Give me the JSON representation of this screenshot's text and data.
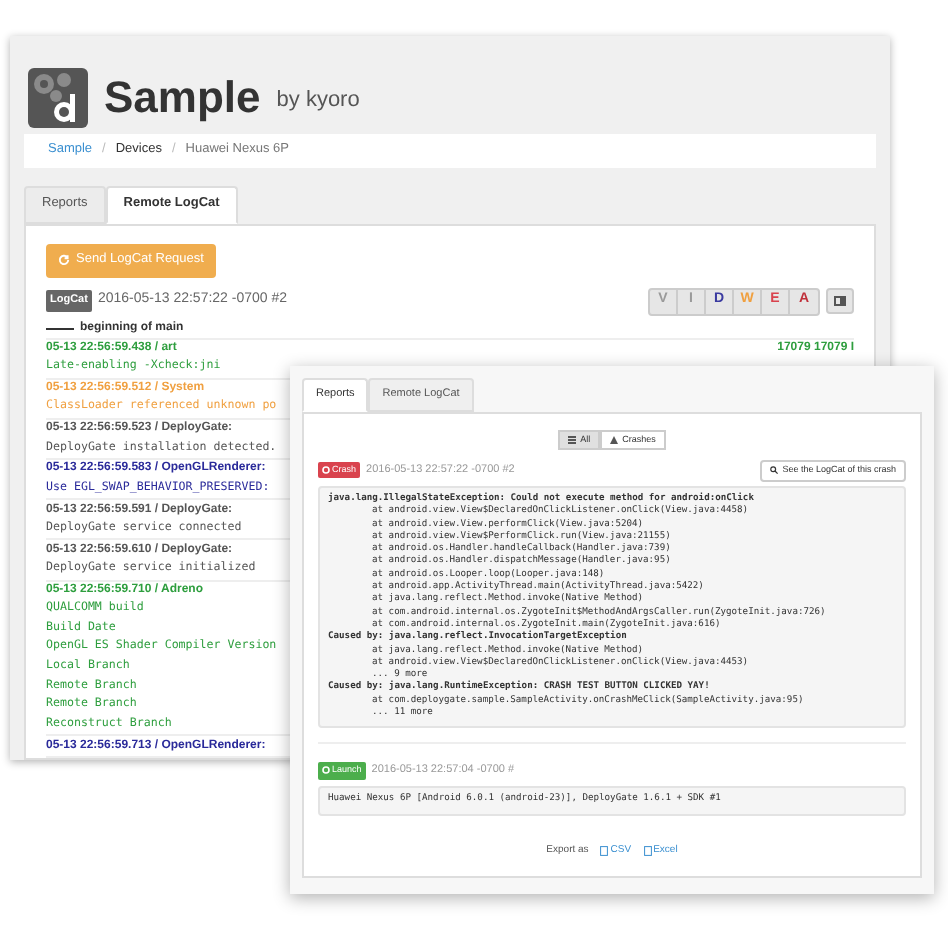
{
  "back_window": {
    "app_title": "Sample",
    "app_owner": "by kyoro",
    "breadcrumb": [
      {
        "label": "Sample",
        "link": true
      },
      {
        "label": "Devices",
        "link": false
      },
      {
        "label": "Huawei Nexus 6P",
        "link": false
      }
    ],
    "breadcrumb_separator": "/",
    "tabs": [
      {
        "label": "Reports",
        "selected": false
      },
      {
        "label": "Remote LogCat",
        "selected": true
      }
    ],
    "send_button": "Send LogCat Request",
    "logcat_badge": "LogCat",
    "logcat_time": "2016-05-13 22:57:22 -0700 #2",
    "level_filters": [
      {
        "label": "V",
        "color": "#9a9a9a"
      },
      {
        "label": "I",
        "color": "#9a9a9a"
      },
      {
        "label": "D",
        "color": "#3a3aa0"
      },
      {
        "label": "W",
        "color": "#f0a040"
      },
      {
        "label": "E",
        "color": "#d9434e"
      },
      {
        "label": "A",
        "color": "#c0303a"
      }
    ],
    "log_start": "beginning of main",
    "log_entries": [
      {
        "color": "#2e9e3e",
        "header": "05-13 22:56:59.438 / art",
        "ids": "17079 17079 I",
        "lines": [
          "Late-enabling -Xcheck:jni"
        ]
      },
      {
        "color": "#f0a040",
        "header": "05-13 22:56:59.512 / System",
        "lines": [
          "ClassLoader referenced unknown po"
        ]
      },
      {
        "color": "#555555",
        "header": "05-13 22:56:59.523 / DeployGate:",
        "lines": [
          "DeployGate installation detected."
        ]
      },
      {
        "color": "#2a2a9a",
        "header": "05-13 22:56:59.583 / OpenGLRenderer:",
        "lines": [
          "Use EGL_SWAP_BEHAVIOR_PRESERVED:"
        ]
      },
      {
        "color": "#555555",
        "header": "05-13 22:56:59.591 / DeployGate:",
        "lines": [
          "DeployGate service connected"
        ]
      },
      {
        "color": "#555555",
        "header": "05-13 22:56:59.610 / DeployGate:",
        "lines": [
          "DeployGate service initialized"
        ]
      },
      {
        "color": "#2e9e3e",
        "header": "05-13 22:56:59.710 / Adreno",
        "lines": [
          "QUALCOMM build",
          "Build Date",
          "OpenGL ES Shader Compiler Version",
          "Local Branch",
          "Remote Branch",
          "Remote Branch",
          "Reconstruct Branch"
        ]
      },
      {
        "color": "#2a2a9a",
        "header": "05-13 22:56:59.713 / OpenGLRenderer:"
      }
    ]
  },
  "front_window": {
    "tabs": [
      {
        "label": "Reports",
        "selected": true
      },
      {
        "label": "Remote LogCat",
        "selected": false
      }
    ],
    "filters": [
      {
        "label": "All",
        "selected": true
      },
      {
        "label": "Crashes",
        "selected": false
      }
    ],
    "reports": [
      {
        "kind": "crash",
        "badge": "Crash",
        "time": "2016-05-13 22:57:22 -0700 #2",
        "action": "See the LogCat of this crash",
        "lines": [
          {
            "kind": "exception",
            "text": "java.lang.IllegalStateException: Could not execute method for android:onClick"
          },
          {
            "kind": "frame",
            "text": "at android.view.View$DeclaredOnClickListener.onClick(View.java:4458)"
          },
          {
            "kind": "frame",
            "text": "at android.view.View.performClick(View.java:5204)"
          },
          {
            "kind": "frame",
            "text": "at android.view.View$PerformClick.run(View.java:21155)"
          },
          {
            "kind": "frame",
            "text": "at android.os.Handler.handleCallback(Handler.java:739)"
          },
          {
            "kind": "frame",
            "text": "at android.os.Handler.dispatchMessage(Handler.java:95)"
          },
          {
            "kind": "frame",
            "text": "at android.os.Looper.loop(Looper.java:148)"
          },
          {
            "kind": "frame",
            "text": "at android.app.ActivityThread.main(ActivityThread.java:5422)"
          },
          {
            "kind": "frame",
            "text": "at java.lang.reflect.Method.invoke(Native Method)"
          },
          {
            "kind": "frame",
            "text": "at com.android.internal.os.ZygoteInit$MethodAndArgsCaller.run(ZygoteInit.java:726)"
          },
          {
            "kind": "frame",
            "text": "at com.android.internal.os.ZygoteInit.main(ZygoteInit.java:616)"
          },
          {
            "kind": "cause",
            "text": "Caused by: java.lang.reflect.InvocationTargetException"
          },
          {
            "kind": "frame",
            "text": "at java.lang.reflect.Method.invoke(Native Method)"
          },
          {
            "kind": "frame",
            "text": "at android.view.View$DeclaredOnClickListener.onClick(View.java:4453)"
          },
          {
            "kind": "frame",
            "text": "... 9 more"
          },
          {
            "kind": "cause",
            "text": "Caused by: java.lang.RuntimeException: CRASH TEST BUTTON CLICKED YAY!"
          },
          {
            "kind": "frame",
            "text": "at com.deploygate.sample.SampleActivity.onCrashMeClick(SampleActivity.java:95)"
          },
          {
            "kind": "frame",
            "text": "... 11 more"
          }
        ]
      },
      {
        "kind": "launch",
        "badge": "Launch",
        "time": "2016-05-13 22:57:04 -0700 #",
        "lines": [
          {
            "kind": "plain",
            "text": "Huawei Nexus 6P [Android 6.0.1 (android-23)], DeployGate 1.6.1 + SDK #1"
          }
        ]
      }
    ],
    "export_label": "Export as",
    "exports": [
      "CSV",
      "Excel"
    ]
  }
}
